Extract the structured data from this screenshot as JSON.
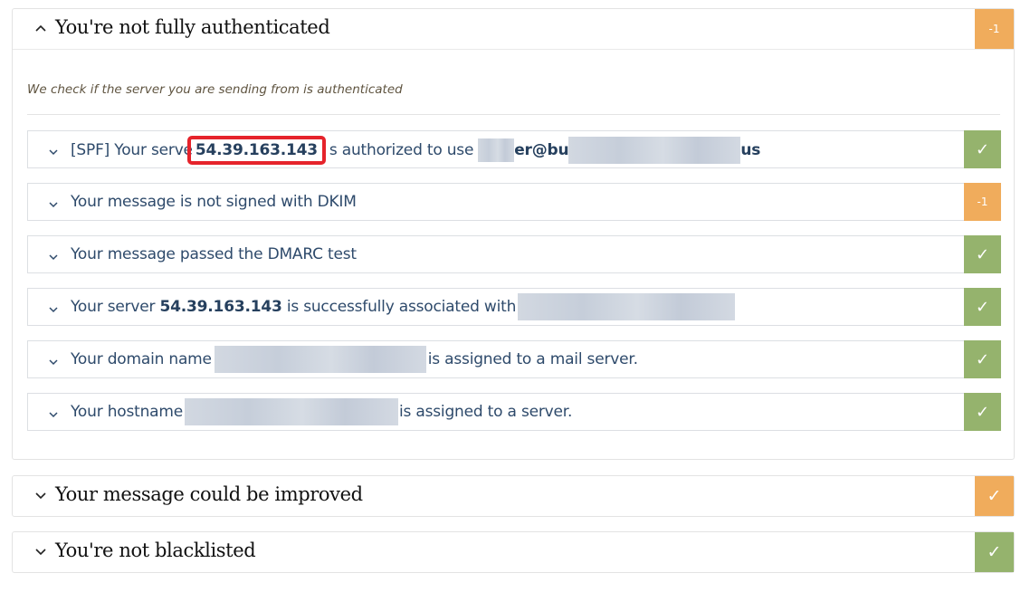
{
  "section_auth": {
    "title": "You're not fully authenticated",
    "badge": "-1",
    "description": "We check if the server you are sending from is authenticated",
    "checks": [
      {
        "prefix": "[SPF] Your serve",
        "ip": "54.39.163.143",
        "middle": "s authorized to use",
        "email_start": "er@bu",
        "email_end": "us",
        "badge": "✓"
      },
      {
        "text": "Your message is not signed with DKIM",
        "badge": "-1"
      },
      {
        "text": "Your message passed the DMARC test",
        "badge": "✓"
      },
      {
        "prefix": "Your server",
        "ip": "54.39.163.143",
        "suffix": "is successfully associated with",
        "badge": "✓"
      },
      {
        "prefix": "Your domain name",
        "suffix": "is assigned to a mail server.",
        "badge": "✓"
      },
      {
        "prefix": "Your hostname",
        "suffix": "is assigned to a server.",
        "badge": "✓"
      }
    ]
  },
  "section_improve": {
    "title": "Your message could be improved",
    "badge": "✓"
  },
  "section_blacklist": {
    "title": "You're not blacklisted",
    "badge": "✓"
  },
  "colors": {
    "orange": "#f0ac5c",
    "green": "#95b36d",
    "highlight": "#e5232b",
    "text": "#2e4a6b"
  },
  "icons": {
    "expanded": "chevron-up-icon",
    "collapsed": "chevron-down-icon",
    "pass": "check-icon"
  }
}
